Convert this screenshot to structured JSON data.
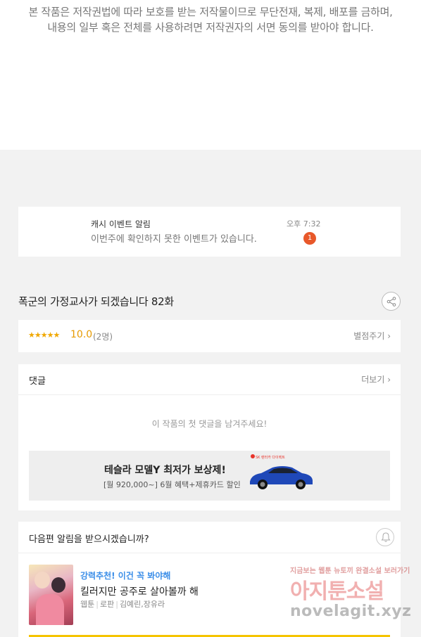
{
  "copyright": {
    "line1": "본 작품은 저작권법에 따라 보호를 받는 저작물이므로 무단전재, 복제,  배포를 금하며,",
    "line2": "내용의 일부 혹은 전체를 사용하려면 저작권자의 서면 동의를 받아야 합니다."
  },
  "alarm": {
    "title": "캐시 이벤트 알림",
    "message": "이번주에 확인하지 못한 이벤트가 있습니다.",
    "time": "오후 7:32",
    "badge": "1"
  },
  "episode": {
    "title": "폭군의 가정교사가 되겠습니다 82화"
  },
  "rating": {
    "stars": "★★★★★",
    "score": "10.0",
    "count": "(2명)",
    "rate_button": "별점주기 ›"
  },
  "comments": {
    "title": "댓글",
    "more": "더보기 ›",
    "empty": "이 작품의 첫 댓글을 남겨주세요!"
  },
  "ad": {
    "title": "테슬라 모델Y 최저가 보상제!",
    "subtitle": "[월 920,000~] 6월 혜택+제휴카드 할인",
    "logo_text": "SK 렌터카 다이렉트"
  },
  "next_alarm": {
    "title": "다음편 알림을 받으시겠습니까?"
  },
  "recommend": {
    "label": "강력추천! 이건 꼭 봐야해",
    "title": "킬러지만 공주로 살아볼까 해",
    "category": "웹툰",
    "genre": "로판",
    "authors": "김예린,장유라"
  },
  "watermark": {
    "line1": "지금보는 웹툰 뉴토끼 완결소설 보러가기",
    "line2": "아지툰소설",
    "line3": "novelagit.xyz"
  },
  "colors": {
    "accent_orange": "#e8582a",
    "star": "#f0a800",
    "link_blue": "#3b8ee8",
    "yellow": "#f5c400"
  }
}
